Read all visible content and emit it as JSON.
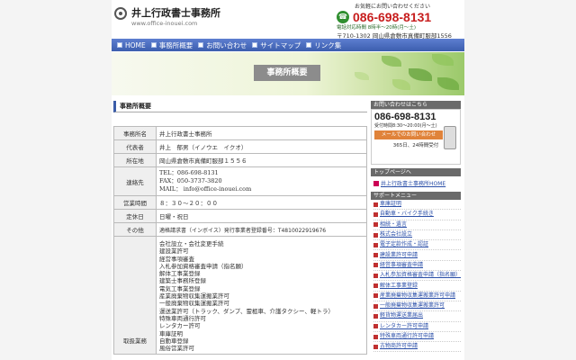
{
  "header": {
    "site_title": "井上行政書士事務所",
    "site_url": "www.office-inouei.com",
    "contact_lead": "お気軽にお問い合わせください",
    "phone": "086-698-8131",
    "hours": "電話対応時間 8時半〜20時(月〜土)",
    "address": "〒710-1302 岡山県倉敷市真備町服部1556"
  },
  "nav": [
    "HOME",
    "事務所概要",
    "お問い合わせ",
    "サイトマップ",
    "リンク集"
  ],
  "banner_label": "事務所概要",
  "section_title": "事務所概要",
  "info": {
    "office_label": "事務所名",
    "office_value": "井上行政書士事務所",
    "rep_label": "代表者",
    "rep_value": "井上　郁男（イノウエ　イクオ）",
    "addr_label": "所在地",
    "addr_value": "岡山県倉敷市真備町服部１５５６",
    "contact_label": "連絡先",
    "tel": "TEL：086-698-8131",
    "fax": "FAX：050-3737-3820",
    "mail": "MAIL： info@office-inouei.com",
    "hours_label": "営業時間",
    "hours_value": "８：３０～２０：００",
    "closed_label": "定休日",
    "closed_value": "日曜・祝日",
    "other_label": "その他",
    "other_value": "適格請求書（インボイス）発行事業者登録番号：T4810022919676",
    "services_label": "取扱業務",
    "services": [
      "会社設立・会社変更手続",
      "建設業許可",
      "経営事項審査",
      "入札参加資格審査申請（指名願）",
      "解体工事業登録",
      "建築士事務所登録",
      "電気工事業登録",
      "産業廃棄物収集運搬業許可",
      "一般廃棄物収集運搬業許可",
      "運送業許可（トラック、ダンプ、霊柩車、介護タクシー、軽トラ）",
      "特殊車両通行許可",
      "レンタカー許可",
      "車庫証明",
      "自動車登録",
      "風俗営業許可"
    ]
  },
  "sidebar": {
    "inquiry_head": "お問い合わせはこちら",
    "phone": "086-698-8131",
    "hours": "受付時間8:30〜20:00(月〜土)",
    "mail_btn": "メールでのお問い合わせ",
    "open365": "365日、24時間受付",
    "top_head": "トップページへ",
    "top_link": "井上行政書士事務所HOME",
    "service_head": "サポートメニュー",
    "items": [
      "車庫証明",
      "自動車・バイク手続き",
      "相続・遺言",
      "株式会社設立",
      "電子定款作成・認証",
      "建設業許可申請",
      "経営事項審査申請",
      "入札参加資格審査申請（指名願）",
      "解体工事業登録",
      "産業廃棄物収集運搬業許可申請",
      "一般廃棄物収集運搬業許可",
      "軽貨物運送業届出",
      "レンタカー許可申請",
      "特殊車両通行許可申請",
      "古物商許可申請"
    ]
  }
}
